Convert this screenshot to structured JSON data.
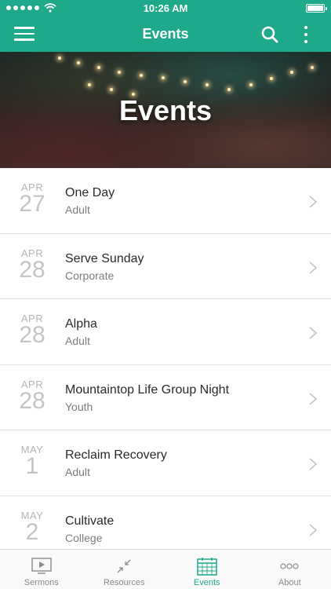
{
  "status_bar": {
    "time": "10:26 AM"
  },
  "nav": {
    "title": "Events"
  },
  "hero": {
    "title": "Events"
  },
  "events": [
    {
      "month": "APR",
      "day": "27",
      "title": "One Day",
      "category": "Adult"
    },
    {
      "month": "APR",
      "day": "28",
      "title": "Serve Sunday",
      "category": "Corporate"
    },
    {
      "month": "APR",
      "day": "28",
      "title": "Alpha",
      "category": "Adult"
    },
    {
      "month": "APR",
      "day": "28",
      "title": "Mountaintop Life Group Night",
      "category": "Youth"
    },
    {
      "month": "MAY",
      "day": "1",
      "title": "Reclaim Recovery",
      "category": "Adult"
    },
    {
      "month": "MAY",
      "day": "2",
      "title": "Cultivate",
      "category": "College"
    }
  ],
  "tabs": [
    {
      "label": "Sermons",
      "icon": "video-play-icon"
    },
    {
      "label": "Resources",
      "icon": "arrows-icon"
    },
    {
      "label": "Events",
      "icon": "calendar-icon"
    },
    {
      "label": "About",
      "icon": "ellipsis-icon"
    }
  ],
  "colors": {
    "accent": "#1ea98a",
    "tab_inactive": "#8a8a8a"
  }
}
